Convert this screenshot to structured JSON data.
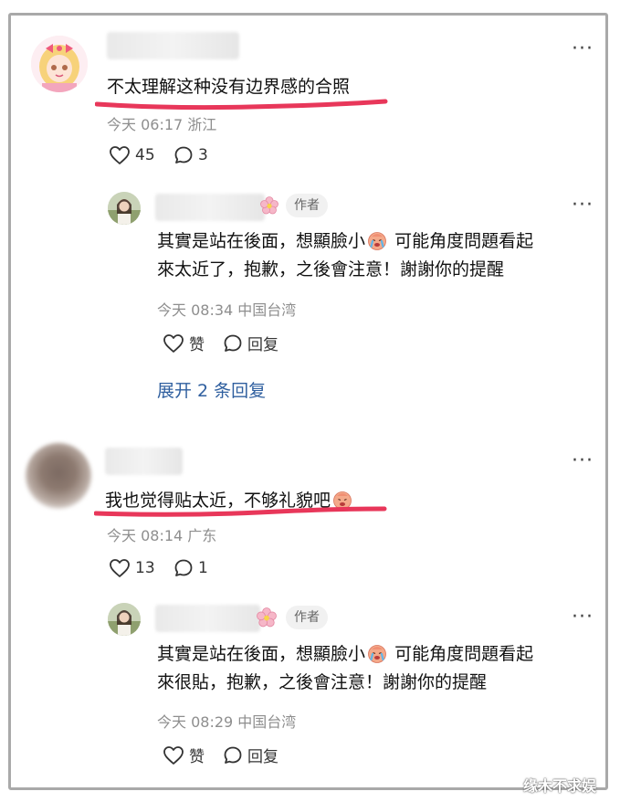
{
  "comments": [
    {
      "text": "不太理解这种没有边界感的合照",
      "time": "今天 06:17",
      "location": "浙江",
      "likes": "45",
      "replies": "3",
      "author_reply": {
        "tag": "作者",
        "line1": "其實是站在後面，想顯臉小",
        "line1b": "可能角度問題看起",
        "line2": "來太近了，抱歉，之後會注意！謝謝你的提醒",
        "time": "今天 08:34",
        "location": "中国台湾",
        "like_label": "赞",
        "reply_label": "回复"
      },
      "expand_label": "展开 2 条回复"
    },
    {
      "text": "我也觉得贴太近，不够礼貌吧",
      "time": "今天 08:14",
      "location": "广东",
      "likes": "13",
      "replies": "1",
      "author_reply": {
        "tag": "作者",
        "line1": "其實是站在後面，想顯臉小",
        "line1b": "可能角度問題看起",
        "line2": "來很貼，抱歉，之後會注意！謝謝你的提醒",
        "time": "今天 08:29",
        "location": "中国台湾",
        "like_label": "赞",
        "reply_label": "回复"
      }
    }
  ],
  "watermark": "缘木不求娱",
  "colors": {
    "underline": "#e8375a",
    "expand_link": "#2f5f9f",
    "meta_gray": "#8e8e8e"
  },
  "icons": [
    "more-icon",
    "heart-icon",
    "comment-icon",
    "crying-emoji-icon",
    "flower-emoji-icon"
  ]
}
